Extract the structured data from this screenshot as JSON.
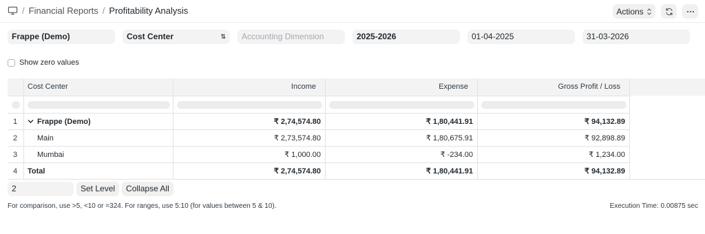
{
  "breadcrumb": {
    "items": [
      "Financial Reports"
    ],
    "current": "Profitability Analysis"
  },
  "toolbar": {
    "actions_label": "Actions",
    "refresh_icon": "refresh-icon",
    "more_icon": "ellipsis-icon"
  },
  "filters": {
    "company": "Frappe (Demo)",
    "based_on": "Cost Center",
    "accounting_dimension_placeholder": "Accounting Dimension",
    "fiscal_year": "2025-2026",
    "from_date": "01-04-2025",
    "to_date": "31-03-2026"
  },
  "show_zero_values_label": "Show zero values",
  "table": {
    "columns": [
      "Cost Center",
      "Income",
      "Expense",
      "Gross Profit / Loss"
    ],
    "rows": [
      {
        "idx": "1",
        "name": "Frappe (Demo)",
        "income": "₹ 2,74,574.80",
        "expense": "₹ 1,80,441.91",
        "gross": "₹ 94,132.89"
      },
      {
        "idx": "2",
        "name": "Main",
        "income": "₹ 2,73,574.80",
        "expense": "₹ 1,80,675.91",
        "gross": "₹ 92,898.89"
      },
      {
        "idx": "3",
        "name": "Mumbai",
        "income": "₹ 1,000.00",
        "expense": "₹ -234.00",
        "gross": "₹ 1,234.00"
      },
      {
        "idx": "4",
        "name": "Total",
        "income": "₹ 2,74,574.80",
        "expense": "₹ 1,80,441.91",
        "gross": "₹ 94,132.89"
      }
    ]
  },
  "tree_controls": {
    "level_value": "2",
    "set_level_label": "Set Level",
    "collapse_all_label": "Collapse All"
  },
  "footer": {
    "hint": "For comparison, use >5, <10 or =324. For ranges, use 5:10 (for values between 5 & 10).",
    "execution_time": "Execution Time: 0.00875 sec"
  }
}
